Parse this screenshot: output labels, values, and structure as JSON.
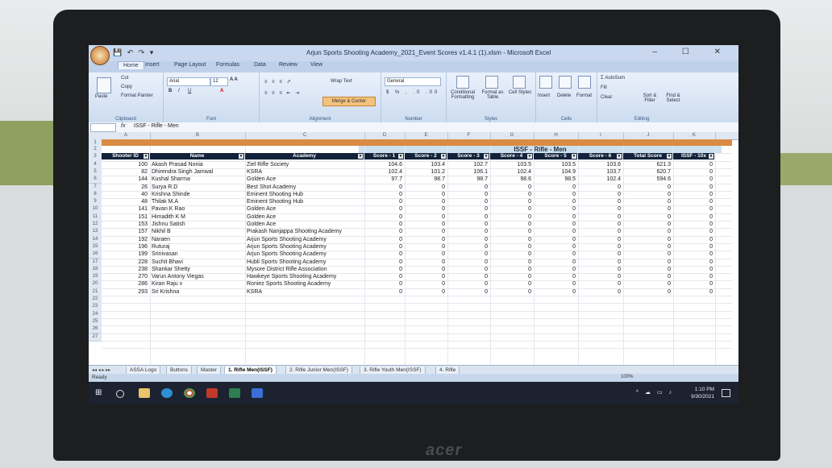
{
  "window": {
    "title": "Arjun Sports Shooting Academy_2021_Event Scores v1.4.1 (1).xlsm - Microsoft Excel",
    "controls": "– ☐ ✕"
  },
  "ribbon_tabs": [
    "Home",
    "Insert",
    "Page Layout",
    "Formulas",
    "Data",
    "Review",
    "View"
  ],
  "ribbon": {
    "clipboard": {
      "paste": "Paste",
      "cut": "Cut",
      "copy": "Copy",
      "format_painter": "Format Painter",
      "label": "Clipboard"
    },
    "font": {
      "name": "Arial",
      "size": "12",
      "label": "Font"
    },
    "alignment": {
      "wrap": "Wrap Text",
      "merge": "Merge & Center",
      "label": "Alignment"
    },
    "number": {
      "format": "General",
      "label": "Number"
    },
    "styles": {
      "conditional": "Conditional Formatting",
      "table": "Format as Table",
      "cell": "Cell Styles",
      "label": "Styles"
    },
    "cells": {
      "insert": "Insert",
      "delete": "Delete",
      "format": "Format",
      "label": "Cells"
    },
    "editing": {
      "autosum": "AutoSum",
      "fill": "Fill",
      "clear": "Clear",
      "sort": "Sort & Filter",
      "find": "Find & Select",
      "label": "Editing"
    }
  },
  "formula_bar": {
    "fx": "fx",
    "content": "ISSF - Rifle - Men"
  },
  "columns": [
    "A",
    "B",
    "C",
    "D",
    "E",
    "F",
    "G",
    "H",
    "I",
    "J",
    "K"
  ],
  "sheet": {
    "banner": "ISSF - Rifle - Men",
    "headers": [
      "Shooter ID",
      "Name",
      "Academy",
      "Score - 1",
      "Score - 2",
      "Score - 3",
      "Score - 4",
      "Score - 5",
      "Score - 6",
      "Total Score",
      "ISSF - 10x"
    ],
    "rows": [
      [
        "100",
        "Akash Prasad Nonia",
        "Ziel Rifle Society",
        "104.6",
        "103.4",
        "102.7",
        "103.5",
        "103.5",
        "103.6",
        "621.3",
        "0"
      ],
      [
        "82",
        "Dhirendra Singh Jamwal",
        "KSRA",
        "102.4",
        "101.2",
        "106.1",
        "102.4",
        "104.9",
        "103.7",
        "620.7",
        "0"
      ],
      [
        "144",
        "Kushal Sharma",
        "Golden Ace",
        "97.7",
        "98.7",
        "98.7",
        "98.6",
        "98.5",
        "102.4",
        "594.6",
        "0"
      ],
      [
        "26",
        "Surya R.D",
        "Best Shot Academy",
        "0",
        "0",
        "0",
        "0",
        "0",
        "0",
        "0",
        "0"
      ],
      [
        "40",
        "Krishna Shinde",
        "Eminent Shooting Hub",
        "0",
        "0",
        "0",
        "0",
        "0",
        "0",
        "0",
        "0"
      ],
      [
        "48",
        "Thilak M.A",
        "Eminent Shooting Hub",
        "0",
        "0",
        "0",
        "0",
        "0",
        "0",
        "0",
        "0"
      ],
      [
        "141",
        "Pavan K Rao",
        "Golden Ace",
        "0",
        "0",
        "0",
        "0",
        "0",
        "0",
        "0",
        "0"
      ],
      [
        "151",
        "Himadith K M",
        "Golden Ace",
        "0",
        "0",
        "0",
        "0",
        "0",
        "0",
        "0",
        "0"
      ],
      [
        "153",
        "Jishnu Satish",
        "Golden Ace",
        "0",
        "0",
        "0",
        "0",
        "0",
        "0",
        "0",
        "0"
      ],
      [
        "157",
        "Nikhil B",
        "Prakash Nanjappa Shooting Academy",
        "0",
        "0",
        "0",
        "0",
        "0",
        "0",
        "0",
        "0"
      ],
      [
        "192",
        "Naraen",
        "Arjun Sports Shooting Academy",
        "0",
        "0",
        "0",
        "0",
        "0",
        "0",
        "0",
        "0"
      ],
      [
        "196",
        "Ruturaj",
        "Arjun Sports Shooting Academy",
        "0",
        "0",
        "0",
        "0",
        "0",
        "0",
        "0",
        "0"
      ],
      [
        "199",
        "Srinivasan",
        "Arjun Sports Shooting Academy",
        "0",
        "0",
        "0",
        "0",
        "0",
        "0",
        "0",
        "0"
      ],
      [
        "228",
        "Suchit Bhavi",
        "Hubli Sports Shooting Academy",
        "0",
        "0",
        "0",
        "0",
        "0",
        "0",
        "0",
        "0"
      ],
      [
        "238",
        "Shankar Shetty",
        "Mysore District Rifle Association",
        "0",
        "0",
        "0",
        "0",
        "0",
        "0",
        "0",
        "0"
      ],
      [
        "270",
        "Varun Antony Viegas",
        "Hawkeye Sports Shooting Academy",
        "0",
        "0",
        "0",
        "0",
        "0",
        "0",
        "0",
        "0"
      ],
      [
        "286",
        "Kiran Raju v",
        "Roniez Sports Shooting Academy",
        "0",
        "0",
        "0",
        "0",
        "0",
        "0",
        "0",
        "0"
      ],
      [
        "293",
        "Sri Krishna",
        "KSRA",
        "0",
        "0",
        "0",
        "0",
        "0",
        "0",
        "0",
        "0"
      ]
    ],
    "row_numbers": [
      "1",
      "2",
      "3",
      "4",
      "5",
      "6",
      "7",
      "8",
      "9",
      "10",
      "11",
      "12",
      "13",
      "14",
      "15",
      "16",
      "17",
      "18",
      "19",
      "20",
      "21",
      "22",
      "23",
      "24",
      "25",
      "26",
      "27"
    ]
  },
  "sheet_tabs": [
    "ASSA Logo",
    "Buttons",
    "Master",
    "1. Rifle Men(ISSF)",
    "2. Rifle Junior Men(ISSF)",
    "3. Rifle Youth Men(ISSF)",
    "4. Rifle"
  ],
  "active_sheet_index": 3,
  "status": {
    "ready": "Ready",
    "zoom": "100%"
  },
  "taskbar": {
    "time": "1:10 PM",
    "date": "9/30/2021"
  },
  "laptop_brand": "acer",
  "colors": {
    "header_fill": "#12223a",
    "row1_fill": "#d98b42",
    "banner_fill": "#cde0f0",
    "excel_blue": "#c9d8ee"
  }
}
